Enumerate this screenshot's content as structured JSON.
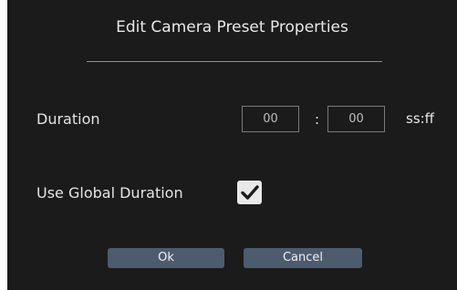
{
  "dialog": {
    "title": "Edit Camera Preset Properties",
    "duration_label": "Duration",
    "duration_seconds": "00",
    "duration_frames": "00",
    "separator": ":",
    "unit_label": "ss:ff",
    "use_global_label": "Use Global Duration",
    "use_global_checked": true,
    "ok_label": "Ok",
    "cancel_label": "Cancel"
  },
  "colors": {
    "background": "#1b1b1b",
    "button": "#4d5b6f",
    "checkbox": "#e9e9e9"
  },
  "icons": {
    "checkbox_mark": "checkmark-icon"
  }
}
